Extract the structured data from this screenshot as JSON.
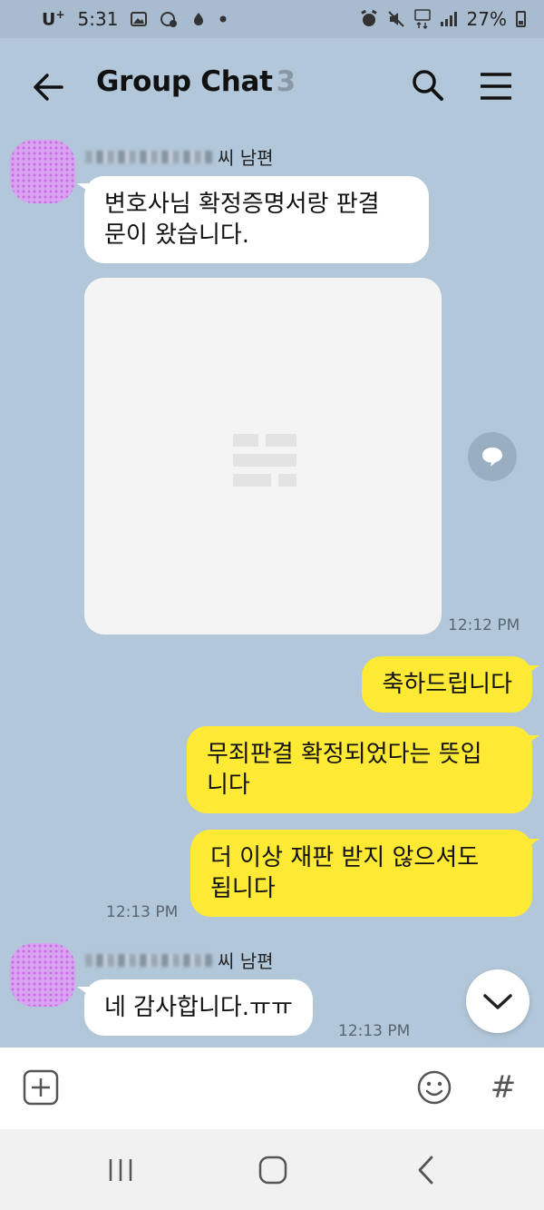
{
  "status_bar": {
    "carrier": "U",
    "carrier_sup": "+",
    "time": "5:31",
    "battery": "27%"
  },
  "header": {
    "title": "Group Chat",
    "member_count": "3"
  },
  "messages": [
    {
      "sender": "씨 남편",
      "text": "변호사님 확정증명서랑 판결문이 왔습니다.",
      "line1": "변호사님 확정증명서랑 판결",
      "line2": "문이 왔습니다.",
      "time": "12:12 PM"
    },
    {
      "text": "축하드립니다"
    },
    {
      "line1": "무죄판결 확정되었다는 뜻입",
      "line2": "니다"
    },
    {
      "line1": "더 이상 재판 받지 않으셔도",
      "line2": "됩니다",
      "time": "12:13 PM"
    },
    {
      "sender": "씨 남편",
      "text": "네 감사합니다.ㅠㅠ",
      "time": "12:13 PM"
    }
  ],
  "input": {
    "placeholder": ""
  },
  "icons": {
    "back": "arrow-left-icon",
    "search": "search-icon",
    "menu": "hamburger-menu-icon",
    "share": "speech-bubble-icon",
    "scroll_down": "chevron-down-icon",
    "add": "plus-square-icon",
    "emoji": "smiley-icon",
    "hash": "#"
  },
  "colors": {
    "chat_background": "#b2c7da",
    "my_bubble": "#fee934",
    "other_bubble": "#ffffff",
    "muted_count": "#8a97a4"
  }
}
